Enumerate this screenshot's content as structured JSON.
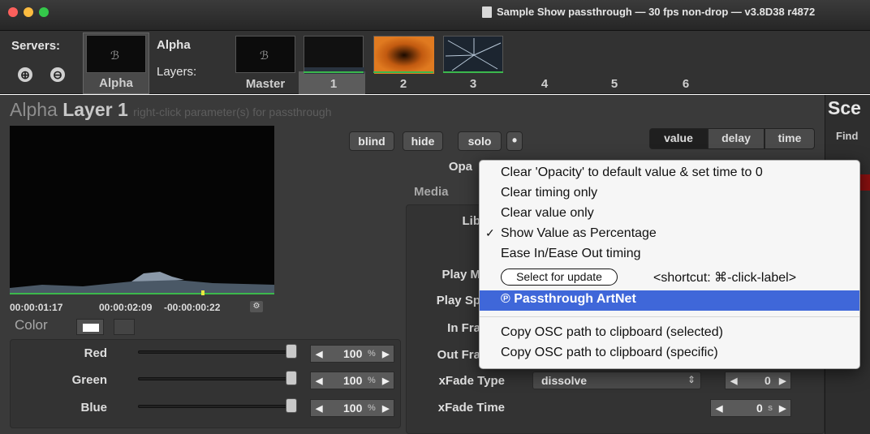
{
  "window": {
    "title": "Sample Show passthrough  —  30 fps non-drop  —  v3.8D38 r4872"
  },
  "servers": {
    "label": "Servers:",
    "add": "⊕",
    "remove": "⊖",
    "selected": "Alpha",
    "alpha_label": "Alpha",
    "layers_label": "Layers:",
    "tabs": [
      "Master",
      "1",
      "2",
      "3",
      "4",
      "5",
      "6"
    ]
  },
  "layer": {
    "alpha": "Alpha",
    "name": "Layer 1",
    "hint": "right-click parameter(s) for passthrough"
  },
  "buttons": {
    "blind": "blind",
    "hide": "hide",
    "solo": "solo",
    "dot": "•",
    "value": "value",
    "delay": "delay",
    "time": "time"
  },
  "timecode": {
    "a": "00:00:01:17",
    "b": "00:00:02:09",
    "c": "-00:00:00:22"
  },
  "color": {
    "label": "Color"
  },
  "sliders": [
    {
      "label": "Red",
      "value": "100",
      "unit": "%"
    },
    {
      "label": "Green",
      "value": "100",
      "unit": "%"
    },
    {
      "label": "Blue",
      "value": "100",
      "unit": "%"
    }
  ],
  "params": {
    "opa": "Opa",
    "media": "Media",
    "lib": "Lib",
    "play_m": "Play M",
    "play_sp": "Play Sp",
    "in_fra": "In Fra",
    "out_fra": "Out Fra",
    "xfade_type": "xFade Type",
    "xfade_type_value": "dissolve",
    "xfade_type_num": "0",
    "xfade_time": "xFade Time",
    "xfade_time_num": "0",
    "xfade_time_unit": "s"
  },
  "scene": {
    "title": "Sce",
    "find": "Find"
  },
  "menu": {
    "items": [
      "Clear 'Opacity' to default value & set time to 0",
      "Clear timing only",
      "Clear value only",
      "Show Value as Percentage",
      "Ease In/Ease Out timing"
    ],
    "checkmark": "✓",
    "select_update": "Select for update",
    "shortcut": "<shortcut: ⌘-click-label>",
    "passthrough": "℗ Passthrough ArtNet",
    "copy_selected": "Copy OSC path to clipboard (selected)",
    "copy_specific": "Copy OSC path to clipboard (specific)"
  }
}
